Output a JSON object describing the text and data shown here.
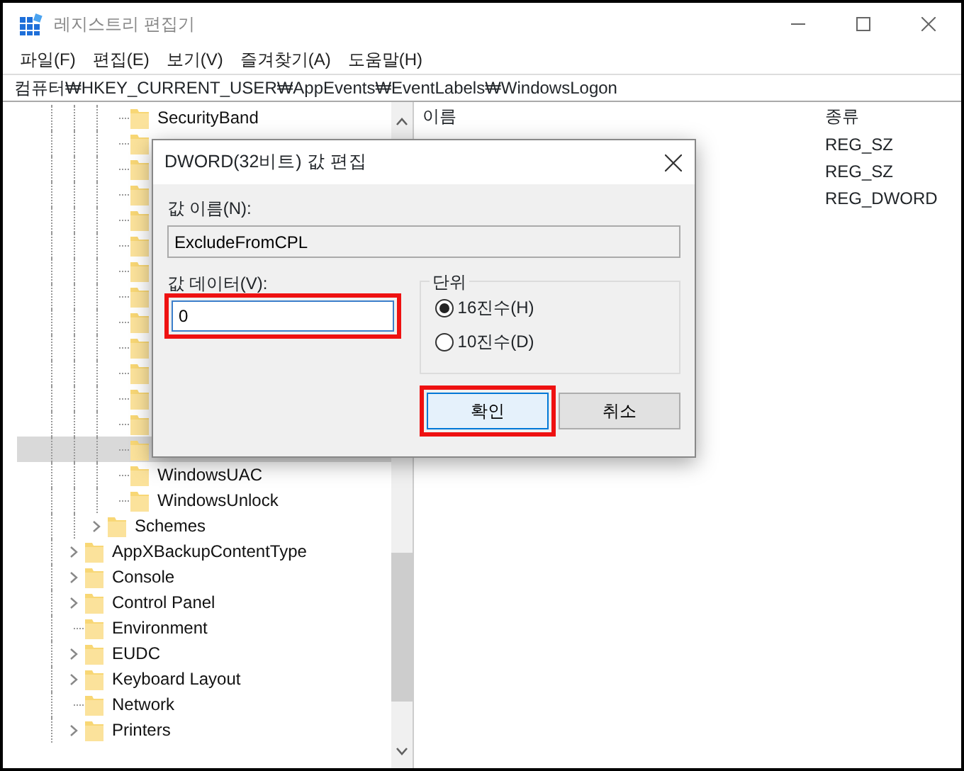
{
  "window": {
    "title": "레지스트리 편집기"
  },
  "menu": [
    "파일(F)",
    "편집(E)",
    "보기(V)",
    "즐겨찾기(A)",
    "도움말(H)"
  ],
  "address": "컴퓨터₩HKEY_CURRENT_USER₩AppEvents₩EventLabels₩WindowsLogon",
  "tree": [
    {
      "children": [
        {
          "children": [
            {
              "label": "SecurityBand",
              "selected": false
            },
            {
              "selected": false
            },
            {
              "selected": false
            },
            {
              "selected": false
            },
            {
              "selected": false
            },
            {
              "selected": false
            },
            {
              "selected": false
            },
            {
              "selected": false
            },
            {
              "selected": false
            },
            {
              "selected": false
            },
            {
              "selected": false
            },
            {
              "selected": false
            },
            {
              "selected": false
            },
            {
              "selected": true
            },
            {
              "label": "WindowsUAC",
              "selected": false
            },
            {
              "label": "WindowsUnlock",
              "selected": false
            }
          ]
        },
        {
          "label": "Schemes",
          "expandable": true,
          "selected": false
        }
      ]
    },
    {
      "label": "AppXBackupContentType",
      "expandable": true,
      "selected": false
    },
    {
      "label": "Console",
      "expandable": true,
      "selected": false
    },
    {
      "label": "Control Panel",
      "expandable": true,
      "selected": false
    },
    {
      "label": "Environment",
      "expandable": false,
      "selected": false
    },
    {
      "label": "EUDC",
      "expandable": true,
      "selected": false
    },
    {
      "label": "Keyboard Layout",
      "expandable": true,
      "selected": false
    },
    {
      "label": "Network",
      "expandable": false,
      "selected": false
    },
    {
      "label": "Printers",
      "expandable": true,
      "selected": false
    }
  ],
  "values": {
    "columns": [
      "이름",
      "종류"
    ],
    "rows": [
      {
        "type": "REG_SZ"
      },
      {
        "type": "REG_SZ"
      },
      {
        "type": "REG_DWORD"
      }
    ]
  },
  "dialog": {
    "title": "DWORD(32비트) 값 편집",
    "name_label": "값 이름(N):",
    "name_value": "ExcludeFromCPL",
    "data_label": "값 데이터(V):",
    "data_value": "0",
    "data_annotated": true,
    "base_group": {
      "title": "단위",
      "options": [
        {
          "label": "16진수(H)",
          "selected": true
        },
        {
          "label": "10진수(D)",
          "selected": false
        }
      ]
    },
    "buttons": [
      {
        "label": "확인",
        "default": true,
        "annotated": true
      },
      {
        "label": "취소",
        "default": false,
        "annotated": false
      }
    ]
  }
}
